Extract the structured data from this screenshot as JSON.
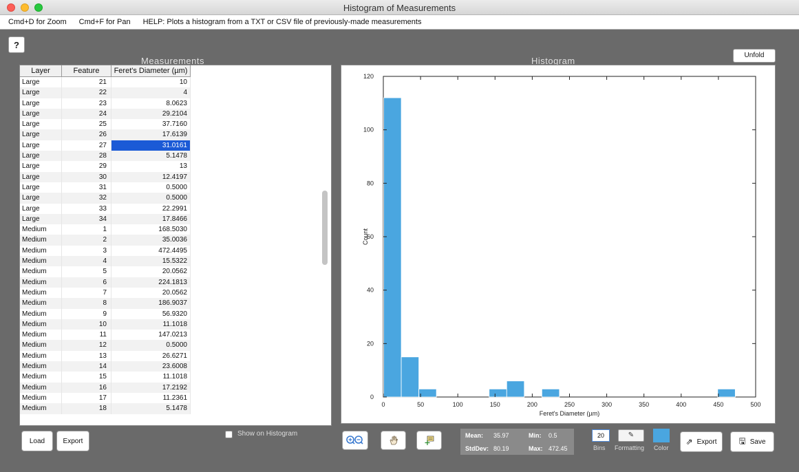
{
  "window": {
    "title": "Histogram of Measurements"
  },
  "menu": {
    "zoom": "Cmd+D for Zoom",
    "pan": "Cmd+F for Pan",
    "help": "HELP:  Plots a histogram from a TXT or CSV file of previously-made measurements"
  },
  "help_button": "?",
  "measurements": {
    "title": "Measurements",
    "columns": [
      "Layer",
      "Feature",
      "Feret's Diameter (µm)"
    ],
    "rows": [
      [
        "Large",
        "21",
        "10"
      ],
      [
        "Large",
        "22",
        "4"
      ],
      [
        "Large",
        "23",
        "8.0623"
      ],
      [
        "Large",
        "24",
        "29.2104"
      ],
      [
        "Large",
        "25",
        "37.7160"
      ],
      [
        "Large",
        "26",
        "17.6139"
      ],
      [
        "Large",
        "27",
        "31.0161"
      ],
      [
        "Large",
        "28",
        "5.1478"
      ],
      [
        "Large",
        "29",
        "13"
      ],
      [
        "Large",
        "30",
        "12.4197"
      ],
      [
        "Large",
        "31",
        "0.5000"
      ],
      [
        "Large",
        "32",
        "0.5000"
      ],
      [
        "Large",
        "33",
        "22.2991"
      ],
      [
        "Large",
        "34",
        "17.8466"
      ],
      [
        "Medium",
        "1",
        "168.5030"
      ],
      [
        "Medium",
        "2",
        "35.0036"
      ],
      [
        "Medium",
        "3",
        "472.4495"
      ],
      [
        "Medium",
        "4",
        "15.5322"
      ],
      [
        "Medium",
        "5",
        "20.0562"
      ],
      [
        "Medium",
        "6",
        "224.1813"
      ],
      [
        "Medium",
        "7",
        "20.0562"
      ],
      [
        "Medium",
        "8",
        "186.9037"
      ],
      [
        "Medium",
        "9",
        "56.9320"
      ],
      [
        "Medium",
        "10",
        "11.1018"
      ],
      [
        "Medium",
        "11",
        "147.0213"
      ],
      [
        "Medium",
        "12",
        "0.5000"
      ],
      [
        "Medium",
        "13",
        "26.6271"
      ],
      [
        "Medium",
        "14",
        "23.6008"
      ],
      [
        "Medium",
        "15",
        "11.1018"
      ],
      [
        "Medium",
        "16",
        "17.2192"
      ],
      [
        "Medium",
        "17",
        "11.2361"
      ],
      [
        "Medium",
        "18",
        "5.1478"
      ]
    ],
    "selected_value": "31.0161",
    "load_label": "Load",
    "export_label": "Export",
    "show_on_histogram_label": "Show on Histogram"
  },
  "histogram": {
    "title": "Histogram",
    "unfold_label": "Unfold",
    "stats": {
      "mean_label": "Mean:",
      "mean": "35.97",
      "min_label": "Min:",
      "min": "0.5",
      "stddev_label": "StdDev:",
      "stddev": "80.19",
      "max_label": "Max:",
      "max": "472.45"
    },
    "bins_value": "20",
    "bins_label": "Bins",
    "formatting_label": "Formatting",
    "color_label": "Color",
    "export_label": "Export",
    "save_label": "Save",
    "bar_color": "#4aa6e0"
  },
  "chart_data": {
    "type": "bar",
    "xlabel": "Feret's Diameter (µm)",
    "ylabel": "Count",
    "xlim": [
      0,
      500
    ],
    "ylim": [
      0,
      120
    ],
    "xticks": [
      0,
      50,
      100,
      150,
      200,
      250,
      300,
      350,
      400,
      450,
      500
    ],
    "yticks": [
      0,
      20,
      40,
      60,
      80,
      100,
      120
    ],
    "bin_width": 23.6,
    "bins": [
      {
        "x0": 0.5,
        "x1": 24.1,
        "count": 112
      },
      {
        "x0": 24.1,
        "x1": 47.7,
        "count": 15
      },
      {
        "x0": 47.7,
        "x1": 71.3,
        "count": 3
      },
      {
        "x0": 71.3,
        "x1": 94.9,
        "count": 0
      },
      {
        "x0": 94.9,
        "x1": 118.5,
        "count": 0
      },
      {
        "x0": 118.5,
        "x1": 142.1,
        "count": 0
      },
      {
        "x0": 142.1,
        "x1": 165.7,
        "count": 3
      },
      {
        "x0": 165.7,
        "x1": 189.3,
        "count": 6
      },
      {
        "x0": 189.3,
        "x1": 212.9,
        "count": 0
      },
      {
        "x0": 212.9,
        "x1": 236.5,
        "count": 3
      },
      {
        "x0": 236.5,
        "x1": 260.1,
        "count": 0
      },
      {
        "x0": 449.0,
        "x1": 472.6,
        "count": 3
      }
    ],
    "grid": false
  }
}
